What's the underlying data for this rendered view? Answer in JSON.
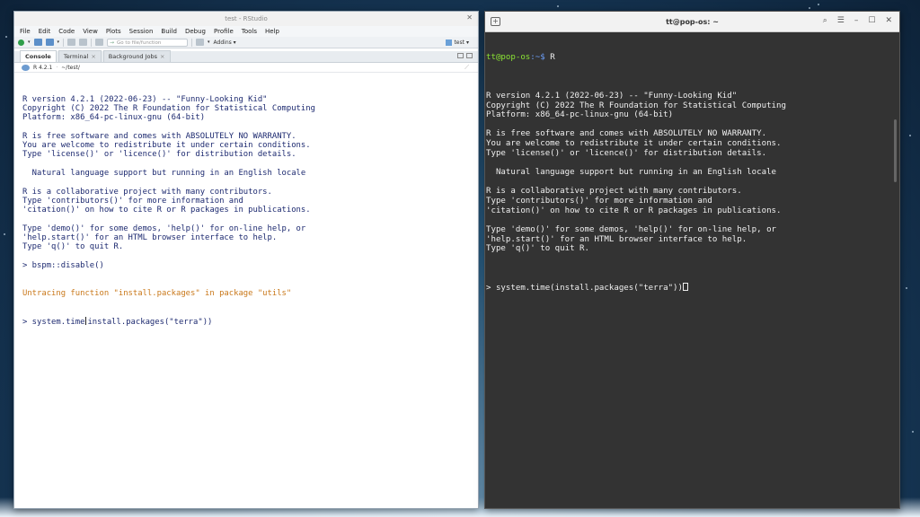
{
  "rstudio": {
    "title": "test - RStudio",
    "menu": [
      "File",
      "Edit",
      "Code",
      "View",
      "Plots",
      "Session",
      "Build",
      "Debug",
      "Profile",
      "Tools",
      "Help"
    ],
    "toolbar": {
      "goto_placeholder": "Go to file/function",
      "addins_label": "Addins",
      "project_label": "test"
    },
    "tabs": [
      {
        "label": "Console"
      },
      {
        "label": "Terminal"
      },
      {
        "label": "Background Jobs"
      }
    ],
    "subbar": {
      "r_version": "R 4.2.1",
      "path": "~/test/"
    },
    "console_lines": [
      "R version 4.2.1 (2022-06-23) -- \"Funny-Looking Kid\"",
      "Copyright (C) 2022 The R Foundation for Statistical Computing",
      "Platform: x86_64-pc-linux-gnu (64-bit)",
      "",
      "R is free software and comes with ABSOLUTELY NO WARRANTY.",
      "You are welcome to redistribute it under certain conditions.",
      "Type 'license()' or 'licence()' for distribution details.",
      "",
      "  Natural language support but running in an English locale",
      "",
      "R is a collaborative project with many contributors.",
      "Type 'contributors()' for more information and",
      "'citation()' on how to cite R or R packages in publications.",
      "",
      "Type 'demo()' for some demos, 'help()' for on-line help, or",
      "'help.start()' for an HTML browser interface to help.",
      "Type 'q()' to quit R.",
      "",
      "> bspm::disable()"
    ],
    "console_trace_line": "Untracing function \"install.packages\" in package \"utils\"",
    "console_cmd_prefix": "> system.time",
    "console_cmd_suffix": "install.packages(\"terra\"))"
  },
  "terminal": {
    "title": "tt@pop-os: ~",
    "prompt_user": "tt@pop-os",
    "prompt_path": ":~$",
    "prompt_cmd": " R",
    "lines": [
      "",
      "R version 4.2.1 (2022-06-23) -- \"Funny-Looking Kid\"",
      "Copyright (C) 2022 The R Foundation for Statistical Computing",
      "Platform: x86_64-pc-linux-gnu (64-bit)",
      "",
      "R is free software and comes with ABSOLUTELY NO WARRANTY.",
      "You are welcome to redistribute it under certain conditions.",
      "Type 'license()' or 'licence()' for distribution details.",
      "",
      "  Natural language support but running in an English locale",
      "",
      "R is a collaborative project with many contributors.",
      "Type 'contributors()' for more information and",
      "'citation()' on how to cite R or R packages in publications.",
      "",
      "Type 'demo()' for some demos, 'help()' for on-line help, or",
      "'help.start()' for an HTML browser interface to help.",
      "Type 'q()' to quit R.",
      ""
    ],
    "final_cmd": "> system.time(install.packages(\"terra\"))"
  }
}
